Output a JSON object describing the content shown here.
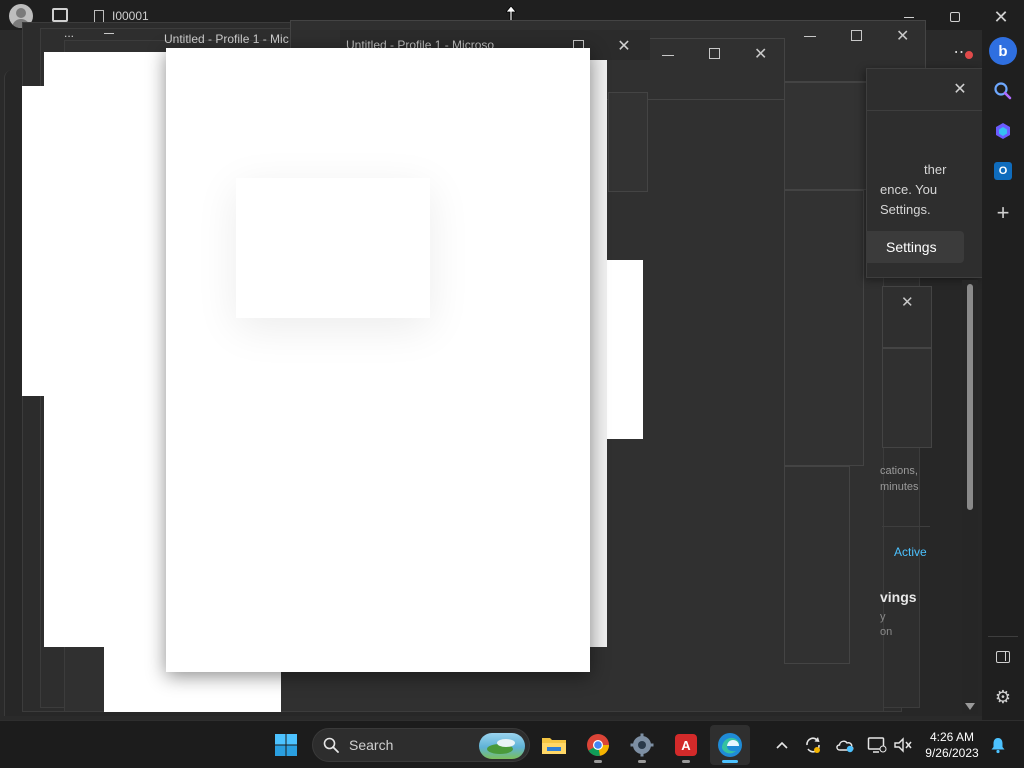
{
  "browser": {
    "tab_label": "I00001",
    "window_title_1": "Untitled - Profile 1 - Mic",
    "window_title_2": "Untitled - Profile 1 - Microso",
    "small_label": "..."
  },
  "panel": {
    "text_lines": [
      "ther",
      "ence. You",
      "Settings."
    ],
    "settings_button": "Settings"
  },
  "lower_panel": {
    "fragment_1": "cations,",
    "fragment_2": "minutes",
    "active_label": "Active",
    "heading": "vings",
    "fragment_3": "y",
    "fragment_4": "on"
  },
  "taskbar": {
    "search_placeholder": "Search",
    "time": "4:26 AM",
    "date": "9/26/2023"
  },
  "colors": {
    "accent": "#4cc2ff",
    "taskbar_bg": "#1c1c1c",
    "window_bg": "#2b2b2b",
    "notification_badge": "#e04a4a"
  },
  "icons": {
    "start": "windows-start-icon",
    "search": "search-icon",
    "explorer": "folder-icon",
    "chrome": "chrome-icon",
    "settings": "gear-icon",
    "acrobat": "acrobat-icon",
    "edge": "edge-icon",
    "tray_chevron": "chevron-up-icon",
    "sync": "sync-icon",
    "onedrive": "cloud-icon",
    "display": "display-icon",
    "volume": "volume-muted-icon",
    "notification": "bell-icon"
  }
}
